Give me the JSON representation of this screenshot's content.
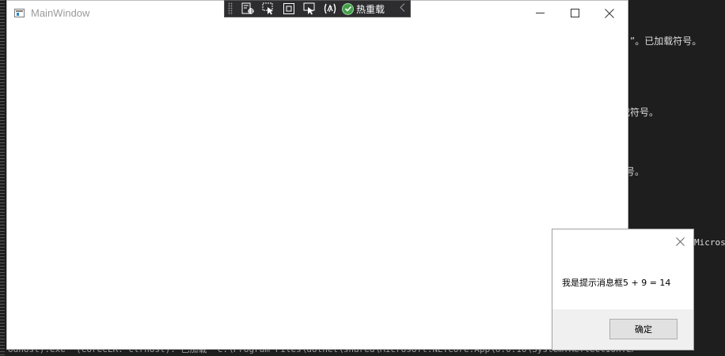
{
  "background_console": {
    "lines": [
      "”。已加载符号。",
      "载符号。",
      "号。",
      "Micros"
    ],
    "bottom_line": "odhost).exe\" (CoreCLR: clrhost): 已加载 \"C:\\Program Files\\dotnet\\shared\\Microsoft.NETCore.App\\6.0.10\\System.Reflection.Emit.Lightweight.dll\"。已加载符号。"
  },
  "main_window": {
    "title": "MainWindow"
  },
  "debug_toolbar": {
    "hot_reload_label": "热重载"
  },
  "message_box": {
    "text": "我是提示消息框5 + 9 = 14",
    "ok_label": "确定"
  },
  "colors": {
    "console_bg": "#1e1e1e",
    "toolbar_bg": "#2d2d30",
    "hot_reload_green": "#43a047",
    "dialog_footer": "#f0f0f0"
  }
}
